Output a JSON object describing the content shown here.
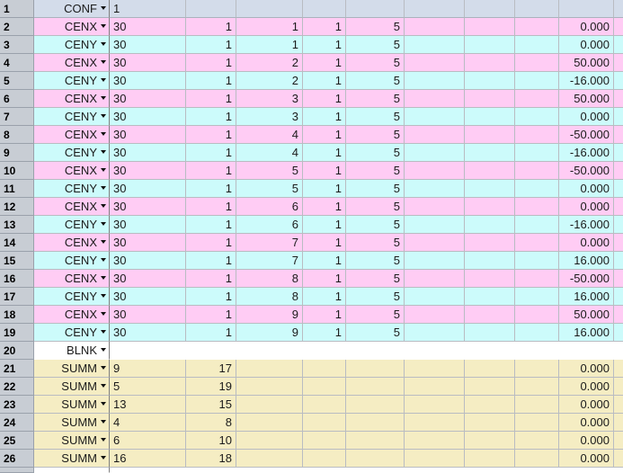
{
  "grid": {
    "row_header_label": "row-number",
    "dropdown_icon": "chevron-down-icon",
    "colors": {
      "header_tint": "#d3dcea",
      "pink_tint": "#ffccf4",
      "cyan_tint": "#ccfbfb",
      "cream_tint": "#f5edc3",
      "blank_tint": "#ffffff",
      "row_header_bg": "#c8cdd4",
      "gridline": "#b9bcc2"
    },
    "columns": [
      {
        "name": "type",
        "align": "right"
      },
      {
        "name": "value-1",
        "align": "left"
      },
      {
        "name": "value-2",
        "align": "right"
      },
      {
        "name": "value-3",
        "align": "right"
      },
      {
        "name": "value-4",
        "align": "right"
      },
      {
        "name": "value-5",
        "align": "right"
      },
      {
        "name": "value-6",
        "align": "right"
      },
      {
        "name": "value-7",
        "align": "right"
      },
      {
        "name": "value-8",
        "align": "right"
      },
      {
        "name": "value-9",
        "align": "right"
      },
      {
        "name": "value-10",
        "align": "right"
      }
    ],
    "rows": [
      {
        "n": "1",
        "tint": "header",
        "type": "CONF",
        "cells": [
          "1",
          "",
          "",
          "",
          "",
          "",
          "",
          "",
          ""
        ]
      },
      {
        "n": "2",
        "tint": "pink",
        "type": "CENX",
        "cells": [
          "30",
          "1",
          "1",
          "1",
          "5",
          "",
          "",
          "",
          "0.000"
        ]
      },
      {
        "n": "3",
        "tint": "cyan",
        "type": "CENY",
        "cells": [
          "30",
          "1",
          "1",
          "1",
          "5",
          "",
          "",
          "",
          "0.000"
        ]
      },
      {
        "n": "4",
        "tint": "pink",
        "type": "CENX",
        "cells": [
          "30",
          "1",
          "2",
          "1",
          "5",
          "",
          "",
          "",
          "50.000"
        ]
      },
      {
        "n": "5",
        "tint": "cyan",
        "type": "CENY",
        "cells": [
          "30",
          "1",
          "2",
          "1",
          "5",
          "",
          "",
          "",
          "-16.000"
        ]
      },
      {
        "n": "6",
        "tint": "pink",
        "type": "CENX",
        "cells": [
          "30",
          "1",
          "3",
          "1",
          "5",
          "",
          "",
          "",
          "50.000"
        ]
      },
      {
        "n": "7",
        "tint": "cyan",
        "type": "CENY",
        "cells": [
          "30",
          "1",
          "3",
          "1",
          "5",
          "",
          "",
          "",
          "0.000"
        ]
      },
      {
        "n": "8",
        "tint": "pink",
        "type": "CENX",
        "cells": [
          "30",
          "1",
          "4",
          "1",
          "5",
          "",
          "",
          "",
          "-50.000"
        ]
      },
      {
        "n": "9",
        "tint": "cyan",
        "type": "CENY",
        "cells": [
          "30",
          "1",
          "4",
          "1",
          "5",
          "",
          "",
          "",
          "-16.000"
        ]
      },
      {
        "n": "10",
        "tint": "pink",
        "type": "CENX",
        "cells": [
          "30",
          "1",
          "5",
          "1",
          "5",
          "",
          "",
          "",
          "-50.000"
        ]
      },
      {
        "n": "11",
        "tint": "cyan",
        "type": "CENY",
        "cells": [
          "30",
          "1",
          "5",
          "1",
          "5",
          "",
          "",
          "",
          "0.000"
        ]
      },
      {
        "n": "12",
        "tint": "pink",
        "type": "CENX",
        "cells": [
          "30",
          "1",
          "6",
          "1",
          "5",
          "",
          "",
          "",
          "0.000"
        ]
      },
      {
        "n": "13",
        "tint": "cyan",
        "type": "CENY",
        "cells": [
          "30",
          "1",
          "6",
          "1",
          "5",
          "",
          "",
          "",
          "-16.000"
        ]
      },
      {
        "n": "14",
        "tint": "pink",
        "type": "CENX",
        "cells": [
          "30",
          "1",
          "7",
          "1",
          "5",
          "",
          "",
          "",
          "0.000"
        ]
      },
      {
        "n": "15",
        "tint": "cyan",
        "type": "CENY",
        "cells": [
          "30",
          "1",
          "7",
          "1",
          "5",
          "",
          "",
          "",
          "16.000"
        ]
      },
      {
        "n": "16",
        "tint": "pink",
        "type": "CENX",
        "cells": [
          "30",
          "1",
          "8",
          "1",
          "5",
          "",
          "",
          "",
          "-50.000"
        ]
      },
      {
        "n": "17",
        "tint": "cyan",
        "type": "CENY",
        "cells": [
          "30",
          "1",
          "8",
          "1",
          "5",
          "",
          "",
          "",
          "16.000"
        ]
      },
      {
        "n": "18",
        "tint": "pink",
        "type": "CENX",
        "cells": [
          "30",
          "1",
          "9",
          "1",
          "5",
          "",
          "",
          "",
          "50.000"
        ]
      },
      {
        "n": "19",
        "tint": "cyan",
        "type": "CENY",
        "cells": [
          "30",
          "1",
          "9",
          "1",
          "5",
          "",
          "",
          "",
          "16.000"
        ]
      },
      {
        "n": "20",
        "tint": "white",
        "type": "BLNK",
        "cells": [
          "",
          "",
          "",
          "",
          "",
          "",
          "",
          "",
          ""
        ]
      },
      {
        "n": "21",
        "tint": "cream",
        "type": "SUMM",
        "cells": [
          "9",
          "17",
          "",
          "",
          "",
          "",
          "",
          "",
          "0.000"
        ]
      },
      {
        "n": "22",
        "tint": "cream",
        "type": "SUMM",
        "cells": [
          "5",
          "19",
          "",
          "",
          "",
          "",
          "",
          "",
          "0.000"
        ]
      },
      {
        "n": "23",
        "tint": "cream",
        "type": "SUMM",
        "cells": [
          "13",
          "15",
          "",
          "",
          "",
          "",
          "",
          "",
          "0.000"
        ]
      },
      {
        "n": "24",
        "tint": "cream",
        "type": "SUMM",
        "cells": [
          "4",
          "8",
          "",
          "",
          "",
          "",
          "",
          "",
          "0.000"
        ]
      },
      {
        "n": "25",
        "tint": "cream",
        "type": "SUMM",
        "cells": [
          "6",
          "10",
          "",
          "",
          "",
          "",
          "",
          "",
          "0.000"
        ]
      },
      {
        "n": "26",
        "tint": "cream",
        "type": "SUMM",
        "cells": [
          "16",
          "18",
          "",
          "",
          "",
          "",
          "",
          "",
          "0.000"
        ]
      }
    ],
    "partial_row": {
      "n": "",
      "tint": "white"
    }
  }
}
